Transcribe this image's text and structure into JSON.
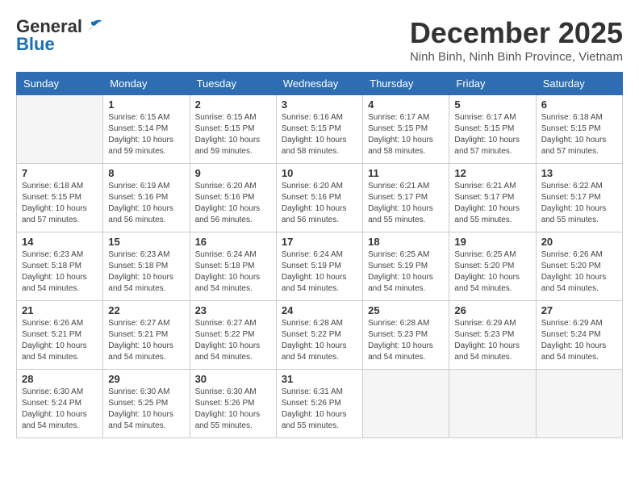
{
  "logo": {
    "general": "General",
    "blue": "Blue"
  },
  "title": "December 2025",
  "location": "Ninh Binh, Ninh Binh Province, Vietnam",
  "days_of_week": [
    "Sunday",
    "Monday",
    "Tuesday",
    "Wednesday",
    "Thursday",
    "Friday",
    "Saturday"
  ],
  "weeks": [
    [
      {
        "day": "",
        "sunrise": "",
        "sunset": "",
        "daylight": ""
      },
      {
        "day": "1",
        "sunrise": "6:15 AM",
        "sunset": "5:14 PM",
        "daylight": "10 hours and 59 minutes."
      },
      {
        "day": "2",
        "sunrise": "6:15 AM",
        "sunset": "5:15 PM",
        "daylight": "10 hours and 59 minutes."
      },
      {
        "day": "3",
        "sunrise": "6:16 AM",
        "sunset": "5:15 PM",
        "daylight": "10 hours and 58 minutes."
      },
      {
        "day": "4",
        "sunrise": "6:17 AM",
        "sunset": "5:15 PM",
        "daylight": "10 hours and 58 minutes."
      },
      {
        "day": "5",
        "sunrise": "6:17 AM",
        "sunset": "5:15 PM",
        "daylight": "10 hours and 57 minutes."
      },
      {
        "day": "6",
        "sunrise": "6:18 AM",
        "sunset": "5:15 PM",
        "daylight": "10 hours and 57 minutes."
      }
    ],
    [
      {
        "day": "7",
        "sunrise": "6:18 AM",
        "sunset": "5:15 PM",
        "daylight": "10 hours and 57 minutes."
      },
      {
        "day": "8",
        "sunrise": "6:19 AM",
        "sunset": "5:16 PM",
        "daylight": "10 hours and 56 minutes."
      },
      {
        "day": "9",
        "sunrise": "6:20 AM",
        "sunset": "5:16 PM",
        "daylight": "10 hours and 56 minutes."
      },
      {
        "day": "10",
        "sunrise": "6:20 AM",
        "sunset": "5:16 PM",
        "daylight": "10 hours and 56 minutes."
      },
      {
        "day": "11",
        "sunrise": "6:21 AM",
        "sunset": "5:17 PM",
        "daylight": "10 hours and 55 minutes."
      },
      {
        "day": "12",
        "sunrise": "6:21 AM",
        "sunset": "5:17 PM",
        "daylight": "10 hours and 55 minutes."
      },
      {
        "day": "13",
        "sunrise": "6:22 AM",
        "sunset": "5:17 PM",
        "daylight": "10 hours and 55 minutes."
      }
    ],
    [
      {
        "day": "14",
        "sunrise": "6:23 AM",
        "sunset": "5:18 PM",
        "daylight": "10 hours and 54 minutes."
      },
      {
        "day": "15",
        "sunrise": "6:23 AM",
        "sunset": "5:18 PM",
        "daylight": "10 hours and 54 minutes."
      },
      {
        "day": "16",
        "sunrise": "6:24 AM",
        "sunset": "5:18 PM",
        "daylight": "10 hours and 54 minutes."
      },
      {
        "day": "17",
        "sunrise": "6:24 AM",
        "sunset": "5:19 PM",
        "daylight": "10 hours and 54 minutes."
      },
      {
        "day": "18",
        "sunrise": "6:25 AM",
        "sunset": "5:19 PM",
        "daylight": "10 hours and 54 minutes."
      },
      {
        "day": "19",
        "sunrise": "6:25 AM",
        "sunset": "5:20 PM",
        "daylight": "10 hours and 54 minutes."
      },
      {
        "day": "20",
        "sunrise": "6:26 AM",
        "sunset": "5:20 PM",
        "daylight": "10 hours and 54 minutes."
      }
    ],
    [
      {
        "day": "21",
        "sunrise": "6:26 AM",
        "sunset": "5:21 PM",
        "daylight": "10 hours and 54 minutes."
      },
      {
        "day": "22",
        "sunrise": "6:27 AM",
        "sunset": "5:21 PM",
        "daylight": "10 hours and 54 minutes."
      },
      {
        "day": "23",
        "sunrise": "6:27 AM",
        "sunset": "5:22 PM",
        "daylight": "10 hours and 54 minutes."
      },
      {
        "day": "24",
        "sunrise": "6:28 AM",
        "sunset": "5:22 PM",
        "daylight": "10 hours and 54 minutes."
      },
      {
        "day": "25",
        "sunrise": "6:28 AM",
        "sunset": "5:23 PM",
        "daylight": "10 hours and 54 minutes."
      },
      {
        "day": "26",
        "sunrise": "6:29 AM",
        "sunset": "5:23 PM",
        "daylight": "10 hours and 54 minutes."
      },
      {
        "day": "27",
        "sunrise": "6:29 AM",
        "sunset": "5:24 PM",
        "daylight": "10 hours and 54 minutes."
      }
    ],
    [
      {
        "day": "28",
        "sunrise": "6:30 AM",
        "sunset": "5:24 PM",
        "daylight": "10 hours and 54 minutes."
      },
      {
        "day": "29",
        "sunrise": "6:30 AM",
        "sunset": "5:25 PM",
        "daylight": "10 hours and 54 minutes."
      },
      {
        "day": "30",
        "sunrise": "6:30 AM",
        "sunset": "5:26 PM",
        "daylight": "10 hours and 55 minutes."
      },
      {
        "day": "31",
        "sunrise": "6:31 AM",
        "sunset": "5:26 PM",
        "daylight": "10 hours and 55 minutes."
      },
      {
        "day": "",
        "sunrise": "",
        "sunset": "",
        "daylight": ""
      },
      {
        "day": "",
        "sunrise": "",
        "sunset": "",
        "daylight": ""
      },
      {
        "day": "",
        "sunrise": "",
        "sunset": "",
        "daylight": ""
      }
    ]
  ],
  "labels": {
    "sunrise_prefix": "Sunrise: ",
    "sunset_prefix": "Sunset: ",
    "daylight_prefix": "Daylight: "
  }
}
